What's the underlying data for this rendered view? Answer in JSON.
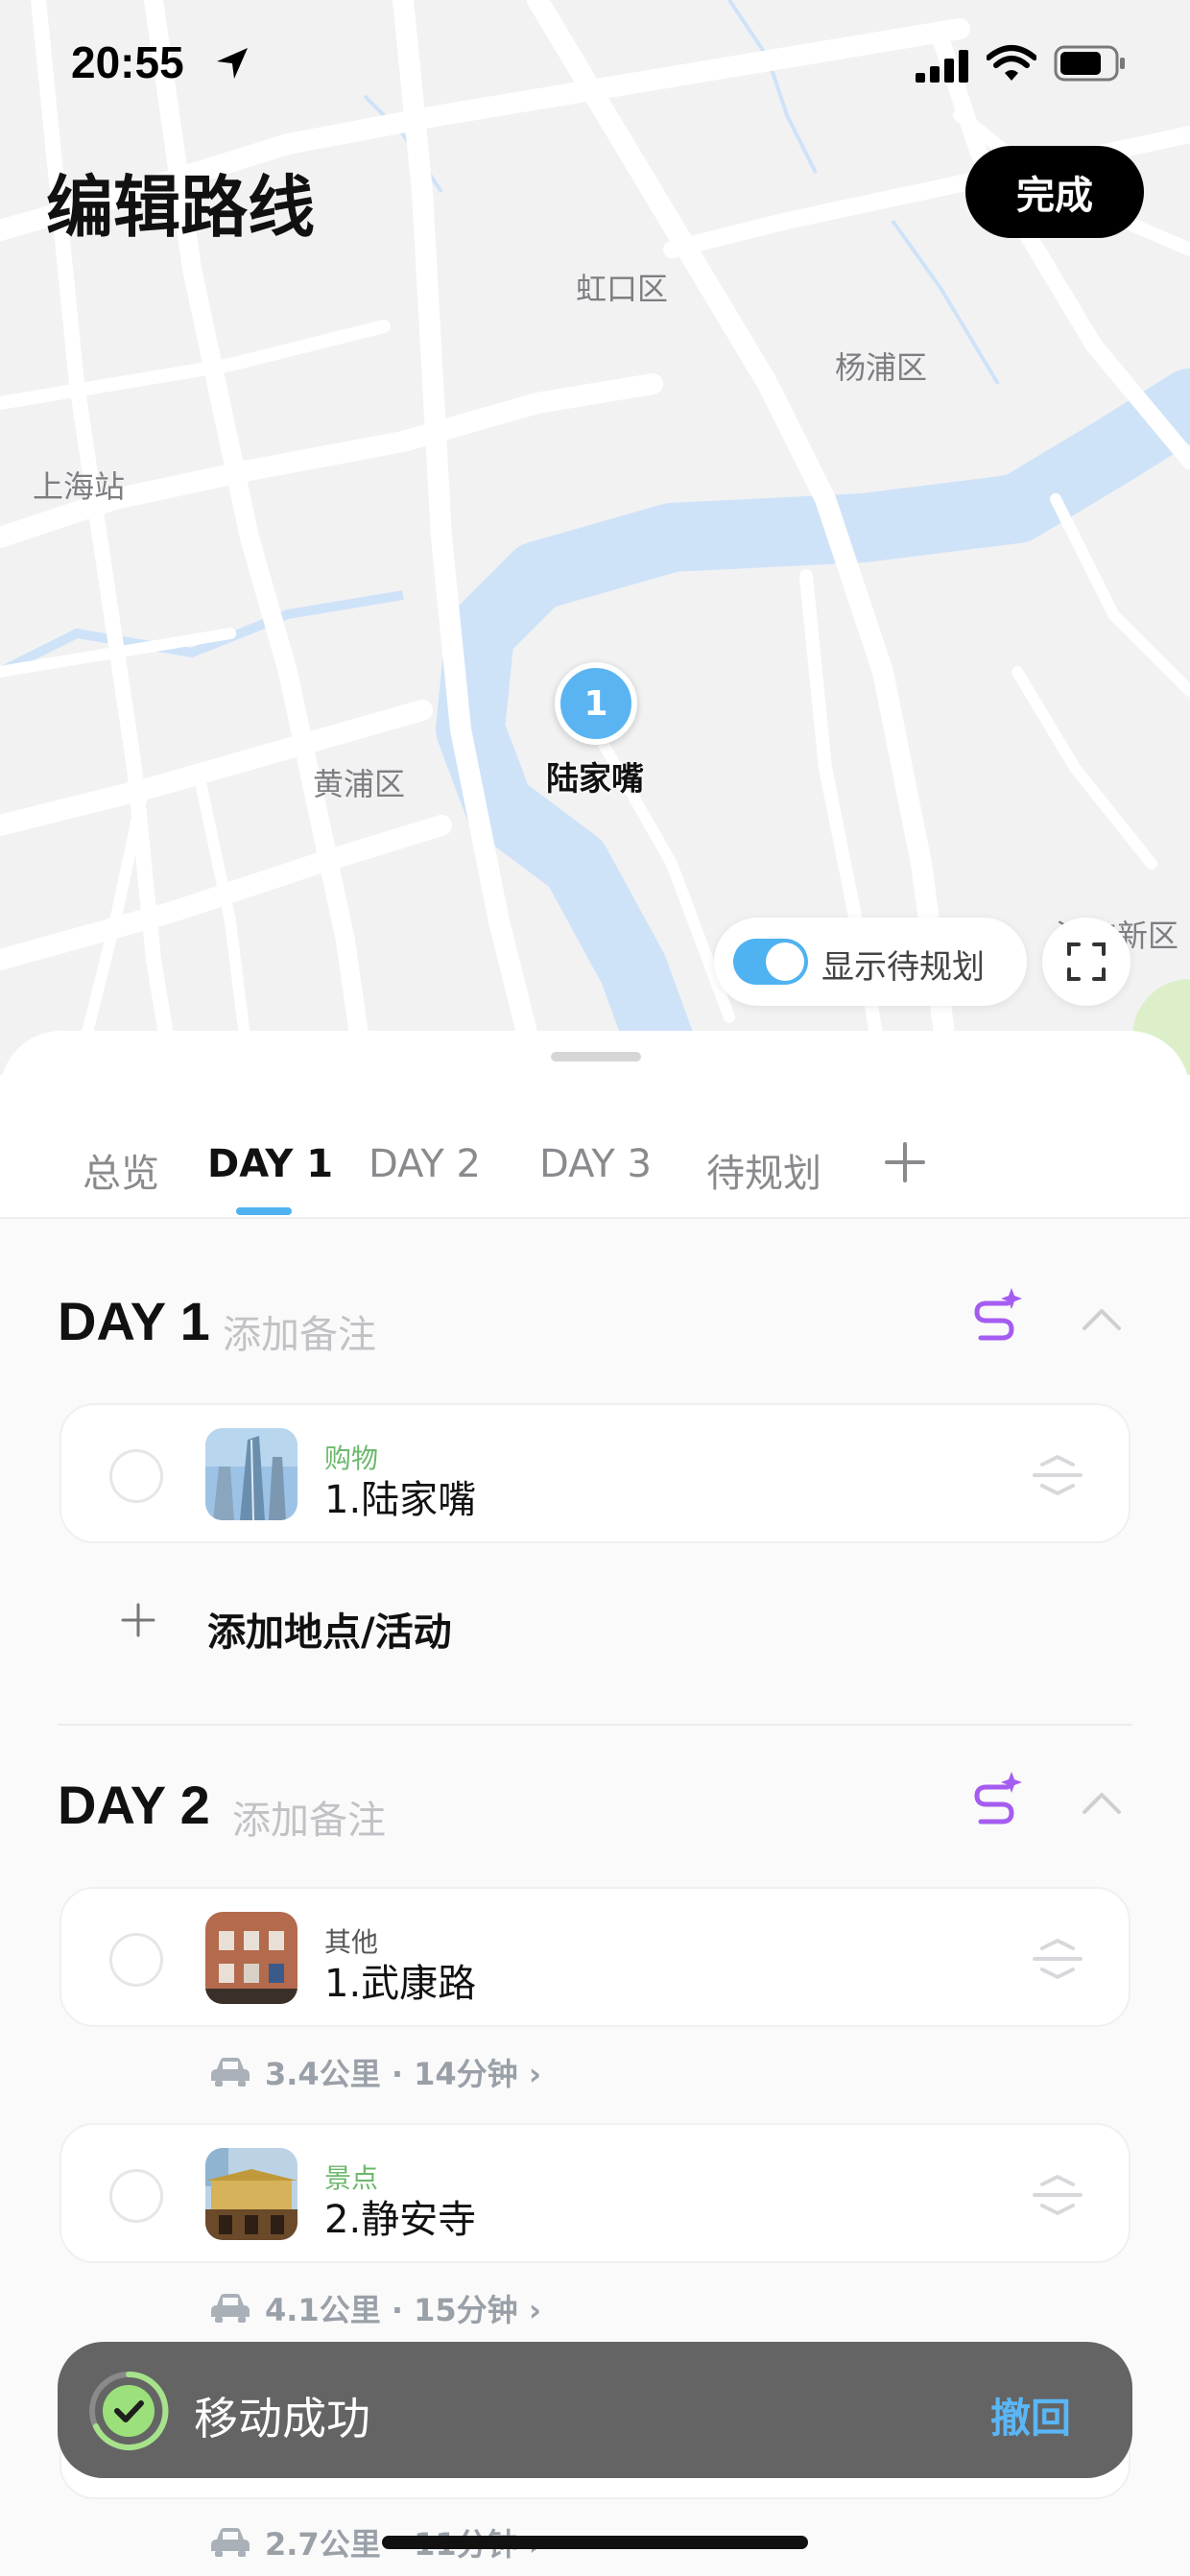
{
  "status_bar": {
    "time": "20:55"
  },
  "header": {
    "title": "编辑路线",
    "done_label": "完成"
  },
  "map": {
    "labels": [
      "虹口区",
      "杨浦区",
      "上海站",
      "黄浦区",
      "浦东新区"
    ],
    "pin": {
      "number": "1",
      "label": "陆家嘴"
    },
    "toggle": {
      "label": "显示待规划",
      "on": true
    },
    "colors": {
      "water": "#cfe3f8",
      "road": "#ffffff",
      "land": "#f2f2f3",
      "park": "#dcefc9"
    }
  },
  "tabs": [
    "总览",
    "DAY 1",
    "DAY 2",
    "DAY 3",
    "待规划"
  ],
  "active_tab": "DAY 1",
  "days": [
    {
      "title": "DAY 1",
      "note_placeholder": "添加备注",
      "places": [
        {
          "category": "购物",
          "category_color": "#6cb86c",
          "name": "1.陆家嘴"
        }
      ],
      "add_label": "添加地点/活动"
    },
    {
      "title": "DAY 2",
      "note_placeholder": "添加备注",
      "places": [
        {
          "category": "其他",
          "category_color": "#555555",
          "name": "1.武康路",
          "route": "3.4公里 · 14分钟"
        },
        {
          "category": "景点",
          "category_color": "#6cb86c",
          "name": "2.静安寺",
          "route": "4.1公里 · 15分钟"
        }
      ],
      "extra_route": "2.7公里 · 11分钟"
    }
  ],
  "toast": {
    "message": "移动成功",
    "undo_label": "撤回"
  },
  "accent_color": "#4fb2f1"
}
